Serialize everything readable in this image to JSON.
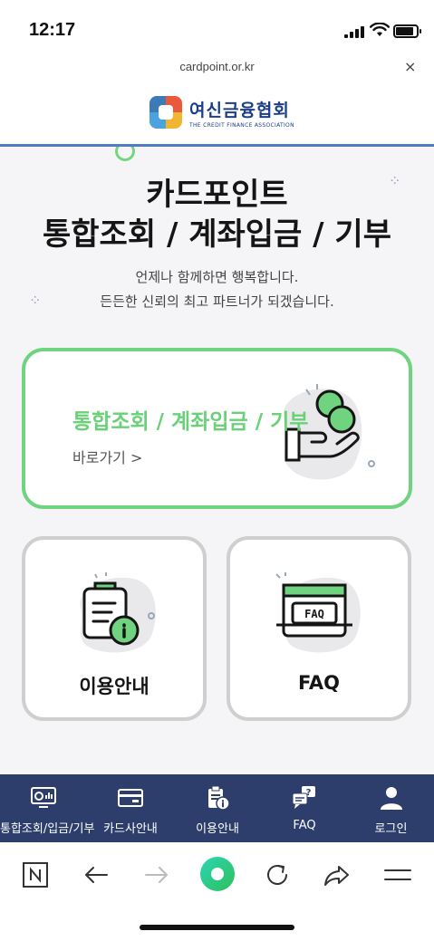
{
  "status_bar": {
    "time": "12:17"
  },
  "browser": {
    "url": "cardpoint.or.kr",
    "close_symbol": "×"
  },
  "site": {
    "logo_text_ko": "여신금융협회",
    "logo_text_en": "THE CREDIT FINANCE ASSOCIATION"
  },
  "hero": {
    "title_line1": "카드포인트",
    "title_line2": "통합조회 / 계좌입금 / 기부",
    "subtitle_line1": "언제나 함께하면 행복합니다.",
    "subtitle_line2": "든든한 신뢰의 최고 파트너가 되겠습니다."
  },
  "cards": {
    "main": {
      "title": "통합조회 / 계좌입금 / 기부",
      "link": "바로가기 >"
    },
    "guide": {
      "label": "이용안내"
    },
    "faq": {
      "label": "FAQ",
      "icon_text": "FAQ"
    }
  },
  "bottom_nav": {
    "items": [
      {
        "label": "통합조회/입금/기부",
        "icon": "monitor-chart-icon"
      },
      {
        "label": "카드사안내",
        "icon": "credit-card-icon"
      },
      {
        "label": "이용안내",
        "icon": "clipboard-info-icon"
      },
      {
        "label": "FAQ",
        "icon": "question-chat-icon"
      },
      {
        "label": "로그인",
        "icon": "user-icon"
      }
    ]
  },
  "colors": {
    "accent_green": "#6fd37f",
    "nav_bg": "#2d3e6c",
    "header_line": "#4e7ec1",
    "logo_blue": "#1c3e86"
  }
}
